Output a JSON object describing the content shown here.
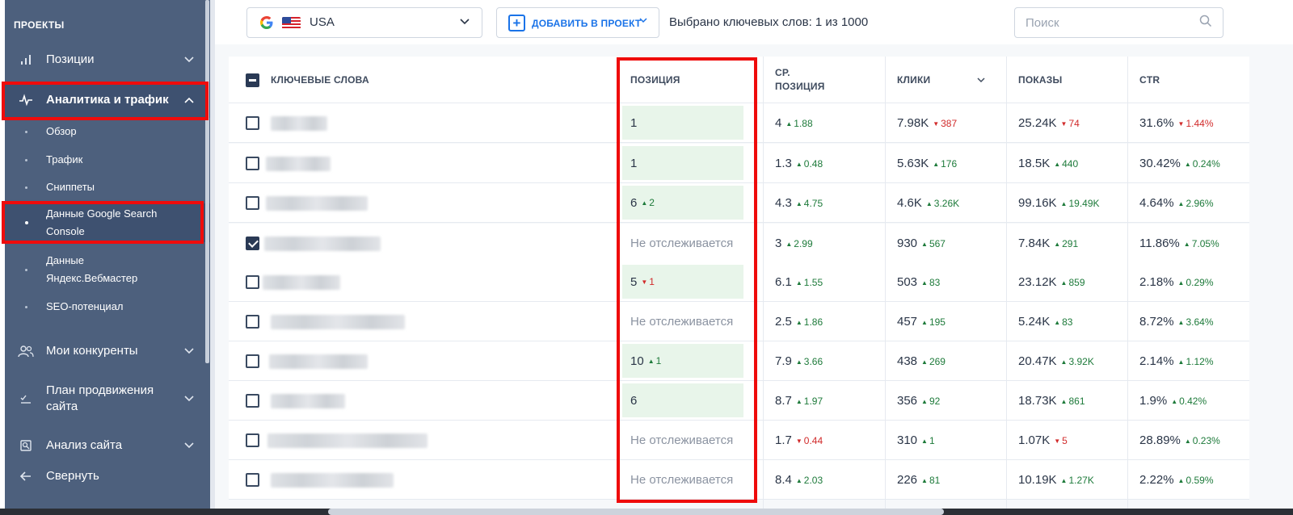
{
  "sidebar": {
    "title": "ПРОЕКТЫ",
    "items": [
      {
        "label": "Позиции"
      },
      {
        "label": "Аналитика и трафик"
      },
      {
        "label": "Мои конкуренты"
      },
      {
        "label": "План продвижения сайта"
      },
      {
        "label": "Анализ сайта"
      },
      {
        "label": "Свернуть"
      }
    ],
    "subitems": [
      {
        "label": "Обзор"
      },
      {
        "label": "Трафик"
      },
      {
        "label": "Сниппеты"
      },
      {
        "label": "Данные Google Search Console"
      },
      {
        "label": "Данные Яндекс.Вебмастер"
      },
      {
        "label": "SEO-потенциал"
      }
    ]
  },
  "toolbar": {
    "region": "USA",
    "add_label": "ДОБАВИТЬ В ПРОЕКТ",
    "selected_count": "Выбрано ключевых слов: 1 из 1000",
    "search_placeholder": "Поиск"
  },
  "table": {
    "headers": {
      "keywords": "КЛЮЧЕВЫЕ СЛОВА",
      "position": "ПОЗИЦИЯ",
      "avg_position_1": "СР.",
      "avg_position_2": "ПОЗИЦИЯ",
      "clicks": "КЛИКИ",
      "impressions": "ПОКАЗЫ",
      "ctr": "CTR"
    },
    "rows": [
      {
        "checked": false,
        "pos": "1",
        "pos_delta": "",
        "pos_dir": "",
        "tracked": true,
        "avg": "4",
        "avg_d": "1.88",
        "avg_dir": "up",
        "clicks": "7.98K",
        "clicks_d": "387",
        "clicks_dir": "down",
        "impr": "25.24K",
        "impr_d": "74",
        "impr_dir": "down",
        "ctr": "31.6%",
        "ctr_d": "1.44%",
        "ctr_dir": "down"
      },
      {
        "checked": false,
        "pos": "1",
        "pos_delta": "",
        "pos_dir": "",
        "tracked": true,
        "avg": "1.3",
        "avg_d": "0.48",
        "avg_dir": "up",
        "clicks": "5.63K",
        "clicks_d": "176",
        "clicks_dir": "up",
        "impr": "18.5K",
        "impr_d": "440",
        "impr_dir": "up",
        "ctr": "30.42%",
        "ctr_d": "0.24%",
        "ctr_dir": "up"
      },
      {
        "checked": false,
        "pos": "6",
        "pos_delta": "2",
        "pos_dir": "up",
        "tracked": true,
        "avg": "4.3",
        "avg_d": "4.75",
        "avg_dir": "up",
        "clicks": "4.6K",
        "clicks_d": "3.26K",
        "clicks_dir": "up",
        "impr": "99.16K",
        "impr_d": "19.49K",
        "impr_dir": "up",
        "ctr": "4.64%",
        "ctr_d": "2.96%",
        "ctr_dir": "up"
      },
      {
        "checked": true,
        "pos": "Не отслеживается",
        "pos_delta": "",
        "pos_dir": "",
        "tracked": false,
        "avg": "3",
        "avg_d": "2.99",
        "avg_dir": "up",
        "clicks": "930",
        "clicks_d": "567",
        "clicks_dir": "up",
        "impr": "7.84K",
        "impr_d": "291",
        "impr_dir": "up",
        "ctr": "11.86%",
        "ctr_d": "7.05%",
        "ctr_dir": "up"
      },
      {
        "checked": false,
        "pos": "5",
        "pos_delta": "1",
        "pos_dir": "down",
        "tracked": true,
        "avg": "6.1",
        "avg_d": "1.55",
        "avg_dir": "up",
        "clicks": "503",
        "clicks_d": "83",
        "clicks_dir": "up",
        "impr": "23.12K",
        "impr_d": "859",
        "impr_dir": "up",
        "ctr": "2.18%",
        "ctr_d": "0.29%",
        "ctr_dir": "up"
      },
      {
        "checked": false,
        "pos": "Не отслеживается",
        "pos_delta": "",
        "pos_dir": "",
        "tracked": false,
        "avg": "2.5",
        "avg_d": "1.86",
        "avg_dir": "up",
        "clicks": "457",
        "clicks_d": "195",
        "clicks_dir": "up",
        "impr": "5.24K",
        "impr_d": "83",
        "impr_dir": "up",
        "ctr": "8.72%",
        "ctr_d": "3.64%",
        "ctr_dir": "up"
      },
      {
        "checked": false,
        "pos": "10",
        "pos_delta": "1",
        "pos_dir": "up",
        "tracked": true,
        "avg": "7.9",
        "avg_d": "3.66",
        "avg_dir": "up",
        "clicks": "438",
        "clicks_d": "269",
        "clicks_dir": "up",
        "impr": "20.47K",
        "impr_d": "3.92K",
        "impr_dir": "up",
        "ctr": "2.14%",
        "ctr_d": "1.12%",
        "ctr_dir": "up"
      },
      {
        "checked": false,
        "pos": "6",
        "pos_delta": "",
        "pos_dir": "",
        "tracked": true,
        "avg": "8.7",
        "avg_d": "1.97",
        "avg_dir": "up",
        "clicks": "356",
        "clicks_d": "92",
        "clicks_dir": "up",
        "impr": "18.73K",
        "impr_d": "861",
        "impr_dir": "up",
        "ctr": "1.9%",
        "ctr_d": "0.42%",
        "ctr_dir": "up"
      },
      {
        "checked": false,
        "pos": "Не отслеживается",
        "pos_delta": "",
        "pos_dir": "",
        "tracked": false,
        "avg": "1.7",
        "avg_d": "0.44",
        "avg_dir": "down",
        "clicks": "310",
        "clicks_d": "1",
        "clicks_dir": "up",
        "impr": "1.07K",
        "impr_d": "5",
        "impr_dir": "down",
        "ctr": "28.89%",
        "ctr_d": "0.23%",
        "ctr_dir": "up"
      },
      {
        "checked": false,
        "pos": "Не отслеживается",
        "pos_delta": "",
        "pos_dir": "",
        "tracked": false,
        "avg": "8.4",
        "avg_d": "2.03",
        "avg_dir": "up",
        "clicks": "226",
        "clicks_d": "81",
        "clicks_dir": "up",
        "impr": "10.19K",
        "impr_d": "1.27K",
        "impr_dir": "up",
        "ctr": "2.22%",
        "ctr_d": "0.59%",
        "ctr_dir": "up"
      }
    ]
  }
}
